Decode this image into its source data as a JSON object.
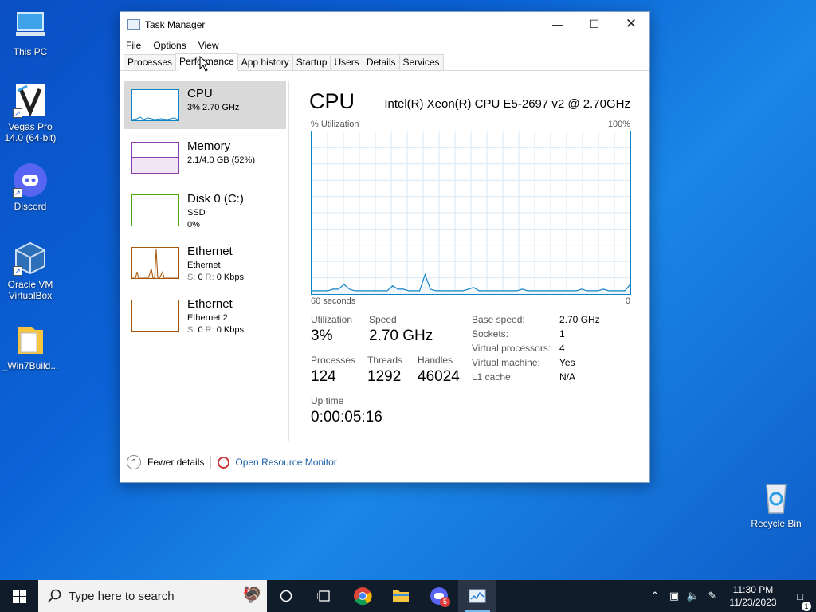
{
  "desktop": {
    "icons": [
      {
        "label": "This PC",
        "icon": "computer-icon"
      },
      {
        "label": "Vegas Pro 14.0 (64-bit)",
        "icon": "vegas-pro-icon"
      },
      {
        "label": "Discord",
        "icon": "discord-icon"
      },
      {
        "label": "Oracle VM VirtualBox",
        "icon": "virtualbox-icon"
      },
      {
        "label": "_Win7Build...",
        "icon": "folder-icon"
      },
      {
        "label": "Recycle Bin",
        "icon": "recycle-bin-icon"
      }
    ]
  },
  "window": {
    "title": "Task Manager",
    "menu": [
      "File",
      "Options",
      "View"
    ],
    "tabs": [
      "Processes",
      "Performance",
      "App history",
      "Startup",
      "Users",
      "Details",
      "Services"
    ],
    "active_tab": "Performance"
  },
  "resources": [
    {
      "name": "CPU",
      "line1": "3% 2.70 GHz",
      "line2": "",
      "color": "#1183c7"
    },
    {
      "name": "Memory",
      "line1": "2.1/4.0 GB (52%)",
      "line2": "",
      "color": "#8b3fa8"
    },
    {
      "name": "Disk 0 (C:)",
      "line1": "SSD",
      "line2": "0%",
      "color": "#4da60c"
    },
    {
      "name": "Ethernet",
      "line1": "Ethernet",
      "line2_s": "S:",
      "line2_v": "0",
      "line2_r": "R:",
      "line2_rv": "0 Kbps",
      "color": "#a7550c"
    },
    {
      "name": "Ethernet",
      "line1": "Ethernet 2",
      "line2_s": "S:",
      "line2_v": "0",
      "line2_r": "R:",
      "line2_rv": "0 Kbps",
      "color": "#a7550c"
    }
  ],
  "detail": {
    "title": "CPU",
    "model": "Intel(R) Xeon(R) CPU E5-2697 v2 @ 2.70GHz",
    "util_label": "% Utilization",
    "util_max": "100%",
    "time_left": "60 seconds",
    "time_right": "0",
    "utilization_label": "Utilization",
    "utilization_value": "3%",
    "speed_label": "Speed",
    "speed_value": "2.70 GHz",
    "processes_label": "Processes",
    "processes_value": "124",
    "threads_label": "Threads",
    "threads_value": "1292",
    "handles_label": "Handles",
    "handles_value": "46024",
    "uptime_label": "Up time",
    "uptime_value": "0:00:05:16",
    "specs": [
      {
        "k": "Base speed:",
        "v": "2.70 GHz"
      },
      {
        "k": "Sockets:",
        "v": "1"
      },
      {
        "k": "Virtual processors:",
        "v": "4"
      },
      {
        "k": "Virtual machine:",
        "v": "Yes"
      },
      {
        "k": "L1 cache:",
        "v": "N/A"
      }
    ]
  },
  "footer": {
    "fewer_details": "Fewer details",
    "resource_monitor": "Open Resource Monitor"
  },
  "taskbar": {
    "search_placeholder": "Type here to search",
    "time": "11:30 PM",
    "date": "11/23/2023",
    "discord_badge": "5",
    "notification_count": "1"
  },
  "cpu_graph": {
    "y_range": [
      0,
      100
    ],
    "values": [
      2,
      2,
      2,
      2,
      3,
      3,
      6,
      3,
      2,
      2,
      2,
      2,
      2,
      2,
      2,
      5,
      3,
      3,
      2,
      2,
      2,
      12,
      3,
      2,
      2,
      2,
      2,
      2,
      2,
      3,
      4,
      2,
      2,
      2,
      2,
      2,
      2,
      2,
      2,
      3,
      2,
      2,
      2,
      2,
      2,
      2,
      2,
      2,
      2,
      2,
      3,
      2,
      2,
      2,
      3,
      2,
      2,
      2,
      2,
      6
    ]
  }
}
